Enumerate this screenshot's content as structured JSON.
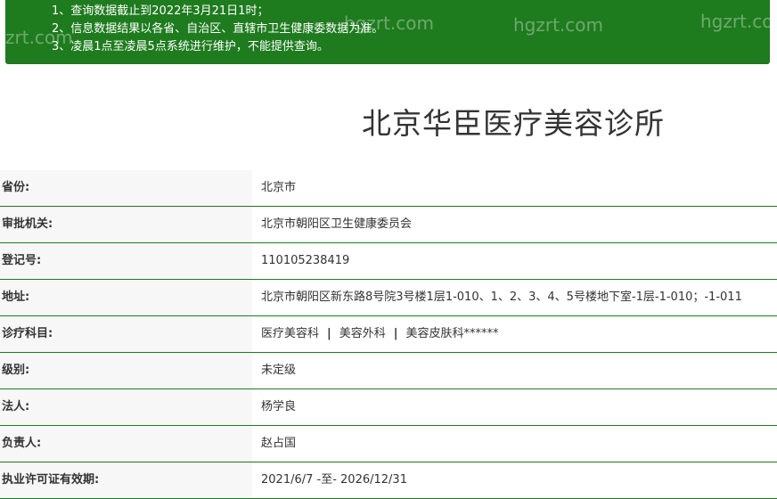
{
  "notice": {
    "lines": [
      "1、查询数据截止到2022年3月21日1时；",
      "2、信息数据结果以各省、自治区、直辖市卫生健康委数据为准。",
      "3、凌晨1点至凌晨5点系统进行维护，不能提供查询。"
    ],
    "watermarks": [
      "zrt.com",
      "hgzrt.com",
      "hgzrt.com",
      "hgzrt.com"
    ]
  },
  "title": "北京华臣医疗美容诊所",
  "rows": [
    {
      "label": "省份:",
      "value": "北京市"
    },
    {
      "label": "审批机关:",
      "value": "北京市朝阳区卫生健康委员会"
    },
    {
      "label": "登记号:",
      "value": "110105238419"
    },
    {
      "label": "地址:",
      "value": "北京市朝阳区新东路8号院3号楼1层1-010、1、2、3、4、5号楼地下室-1层-1-010；-1-011"
    },
    {
      "label": "诊疗科目:",
      "subjects": [
        "医疗美容科",
        "美容外科",
        "美容皮肤科******"
      ],
      "separator": "|"
    },
    {
      "label": "级别:",
      "value": "未定级"
    },
    {
      "label": "法人:",
      "value": "杨学良"
    },
    {
      "label": "负责人:",
      "value": "赵占国"
    },
    {
      "label": "执业许可证有效期:",
      "value": "2021/6/7 -至- 2026/12/31"
    }
  ],
  "colors": {
    "accent": "#1e7b1e",
    "label_bg": "#f7f7f7",
    "text": "#333333"
  }
}
